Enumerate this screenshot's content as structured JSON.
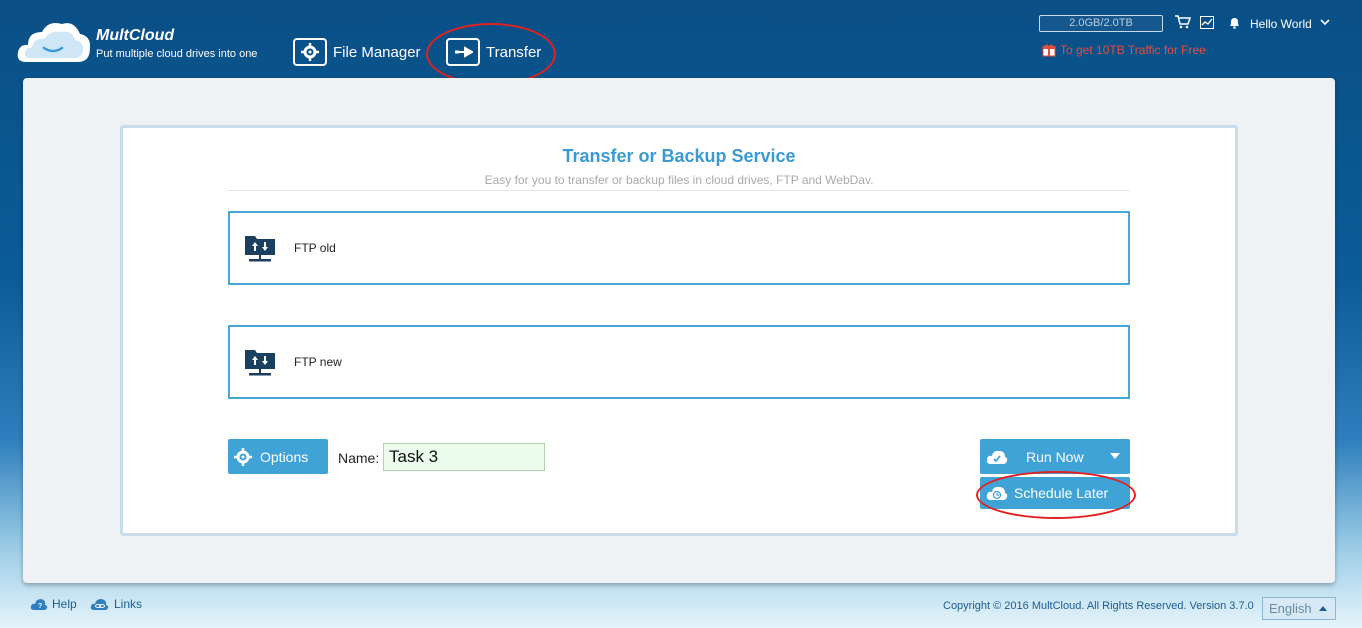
{
  "header": {
    "brand_name": "MultCloud",
    "brand_tagline": "Put multiple cloud drives into one",
    "nav": [
      {
        "label": "File Manager",
        "icon": "gear-folder-icon"
      },
      {
        "label": "Transfer",
        "icon": "transfer-folder-icon"
      }
    ],
    "storage": "2.0GB/2.0TB",
    "user_name": "Hello World",
    "promo": "To get 10TB Traffic for Free"
  },
  "card": {
    "title": "Transfer or Backup Service",
    "subtitle": "Easy for you to transfer or backup files in cloud drives, FTP and WebDav.",
    "source": {
      "label": "FTP old",
      "icon": "ftp-server-icon"
    },
    "target": {
      "label": "FTP new",
      "icon": "ftp-server-icon"
    },
    "options_label": "Options",
    "name_label": "Name:",
    "task_name": "Task 3",
    "run_label": "Run Now",
    "schedule_label": "Schedule Later"
  },
  "footer": {
    "help": "Help",
    "links": "Links",
    "copyright": "Copyright © 2016 MultCloud. All Rights Reserved. Version 3.7.0",
    "language": "English"
  },
  "colors": {
    "accent": "#3fa3d6",
    "title": "#3a9bd0",
    "promo": "#e94b3c",
    "annotation": "#e32020"
  }
}
